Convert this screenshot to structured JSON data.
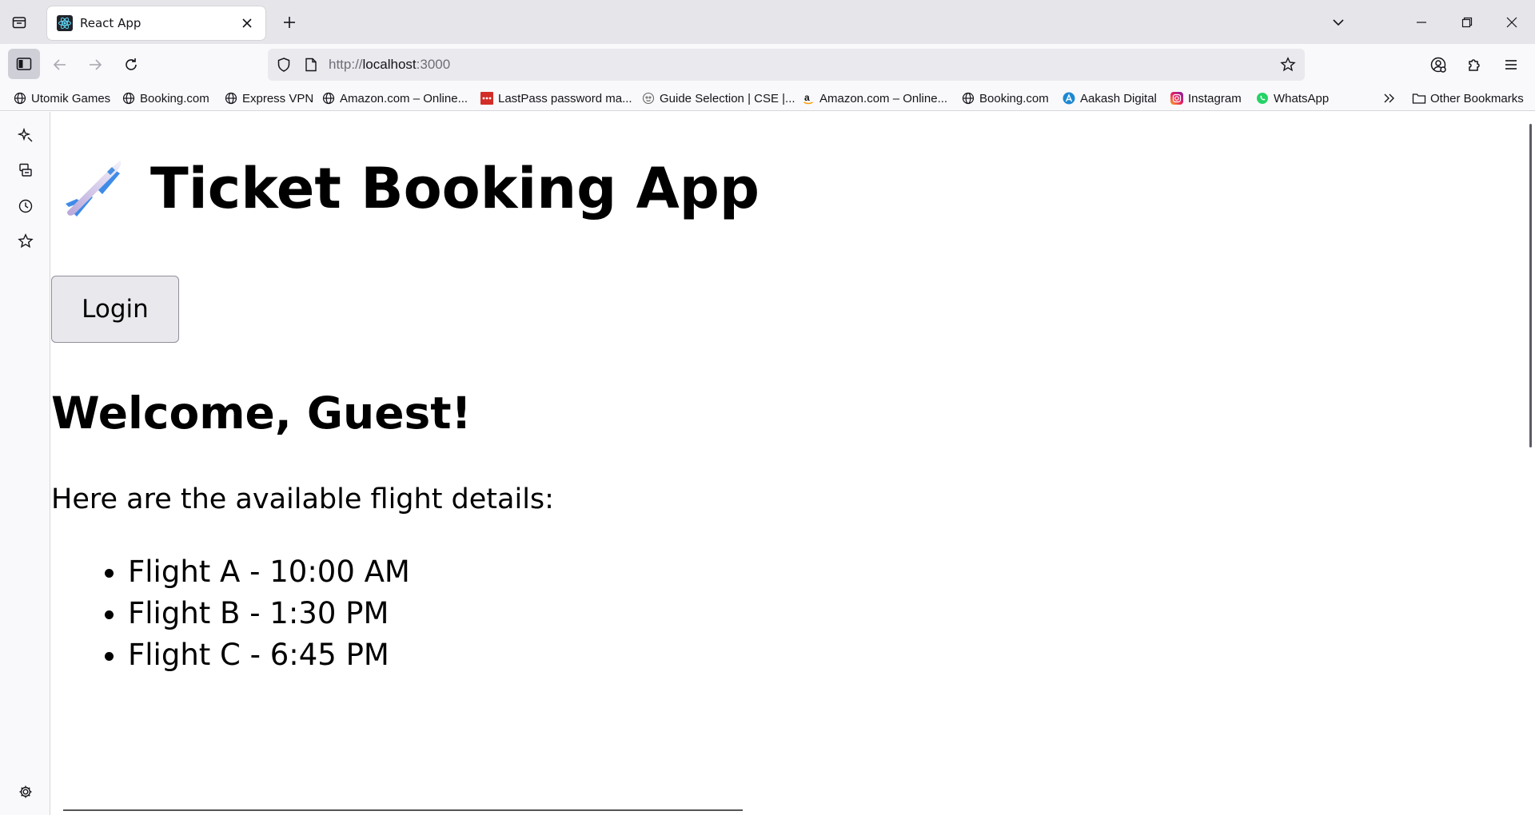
{
  "browser": {
    "tab": {
      "title": "React App"
    },
    "url": {
      "scheme": "http://",
      "host": "localhost",
      "rest": ":3000"
    }
  },
  "bookmarks": [
    {
      "label": "Utomik Games",
      "icon": "globe-icon"
    },
    {
      "label": "Booking.com",
      "icon": "globe-icon"
    },
    {
      "label": "Express VPN",
      "icon": "globe-icon"
    },
    {
      "label": "Amazon.com – Online...",
      "icon": "globe-icon"
    },
    {
      "label": "LastPass password ma...",
      "icon": "lastpass-icon"
    },
    {
      "label": "Guide Selection | CSE |...",
      "icon": "guide-icon"
    },
    {
      "label": "Amazon.com – Online...",
      "icon": "amazon-icon"
    },
    {
      "label": "Booking.com",
      "icon": "globe-icon"
    },
    {
      "label": "Aakash Digital",
      "icon": "aakash-icon"
    },
    {
      "label": "Instagram",
      "icon": "instagram-icon"
    },
    {
      "label": "WhatsApp",
      "icon": "whatsapp-icon"
    }
  ],
  "other_bookmarks": "Other Bookmarks",
  "app": {
    "title": "Ticket Booking App",
    "title_icon": "airplane-emoji",
    "login_label": "Login",
    "welcome": "Welcome, Guest!",
    "intro": "Here are the available flight details:",
    "flights": [
      "Flight A - 10:00 AM",
      "Flight B - 1:30 PM",
      "Flight C - 6:45 PM"
    ]
  },
  "colors": {
    "tabstrip_bg": "#e5e5ea",
    "toolbar_bg": "#f9f9fb",
    "urlbar_bg": "#eaeaee",
    "button_bg": "#e9e9ed"
  }
}
